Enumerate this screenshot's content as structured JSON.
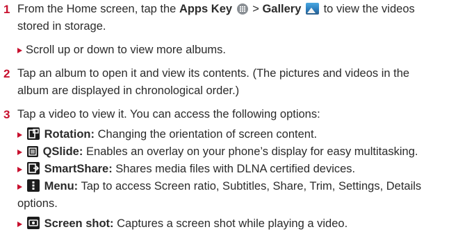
{
  "steps": [
    {
      "number": "1",
      "pre": "From the Home screen, tap the ",
      "apps_key": "Apps Key",
      "apps_key_icon": "apps-grid-icon",
      "sep": " > ",
      "gallery": "Gallery",
      "gallery_icon": "gallery-icon",
      "post_line1": " to view the videos",
      "line2": "stored in storage.",
      "sub": "Scroll up or down to view more albums."
    },
    {
      "number": "2",
      "line1": "Tap an album to open it and view its contents. (The pictures and videos in the",
      "line2": "album are displayed in chronological order.)"
    },
    {
      "number": "3",
      "line1": "Tap a video to view it. You can access the following options:",
      "options": [
        {
          "icon": "rotation-icon",
          "title": "Rotation:",
          "desc": " Changing the orientation of screen content."
        },
        {
          "icon": "qslide-icon",
          "title": "QSlide:",
          "desc": " Enables an overlay on your phone’s display for easy multitasking."
        },
        {
          "icon": "smartshare-icon",
          "title": "SmartShare:",
          "desc": " Shares media files with DLNA certified devices."
        },
        {
          "icon": "menu-icon",
          "title": "Menu:",
          "desc": " Tap to access Screen ratio, Subtitles, Share, Trim, Settings, Details",
          "desc2": "options."
        },
        {
          "icon": "screenshot-icon",
          "title": "Screen shot:",
          "desc": " Captures a screen shot while playing a video."
        }
      ]
    }
  ],
  "colors": {
    "accent": "#c8102e",
    "text": "#2b2b2b",
    "icon_bg": "#1c1c1c"
  }
}
